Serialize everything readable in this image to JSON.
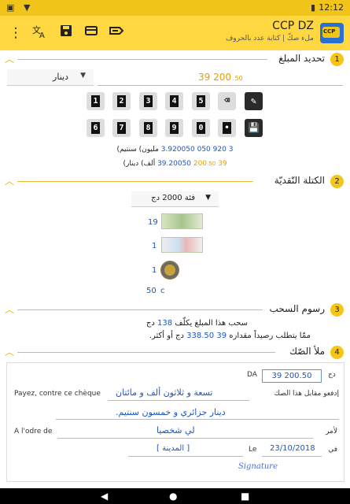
{
  "status_bar": {
    "time": "12:12",
    "icons": [
      "notification-icon",
      "wifi-icon",
      "battery-icon"
    ]
  },
  "app_bar": {
    "title": "CCP DZ",
    "subtitle": "ملء صكّ | كتابة عدد بالحروف",
    "logo_text": "CCP",
    "actions": [
      "menu-icon",
      "translate-icon",
      "save-icon",
      "card-icon",
      "cheque-icon"
    ]
  },
  "sections": {
    "amount": {
      "number": "1",
      "title": "تحديد المبلغ",
      "currency": "دينار",
      "amount_main": "39 200",
      "amount_cents": ".50",
      "keypad": [
        "1",
        "2",
        "3",
        "4",
        "5",
        "⌫",
        "✎",
        "6",
        "7",
        "8",
        "9",
        "0",
        "•",
        "💾"
      ],
      "words_centimes": {
        "figure_a": "3 920 050",
        "figure_b": "3.920050",
        "text": "مليون) سنتيم)"
      },
      "words_dinars": {
        "figure_a": "39 200",
        "figure_a_cents": ".50",
        "figure_b": "39.20050",
        "text": "ألف) دينار)"
      }
    },
    "cash": {
      "number": "2",
      "title": "الكتلة النّقديّة",
      "denomination": "فئة 2000 دج",
      "rows": [
        {
          "count": "19",
          "kind": "banknote-2000"
        },
        {
          "count": "1",
          "kind": "banknote-1000"
        },
        {
          "count": "1",
          "kind": "coin-200"
        },
        {
          "count": "50",
          "unit": "c"
        }
      ]
    },
    "fees": {
      "number": "3",
      "title": "رسوم السحب",
      "line1_prefix": "سحب هذا المبلغ يكلّف",
      "line1_value": "138",
      "line1_suffix": "دج",
      "line2_prefix": "ممّا يتطلب رصيداً مقداره",
      "line2_value": "39 338.50",
      "line2_suffix": "دج أو أكثر."
    },
    "cheque": {
      "number": "4",
      "title": "ملأ الصّك",
      "da_label": "DA",
      "dj_label": "دج",
      "amount_box": "39 200.50",
      "pay_label_fr": "Payez, contre ce chèque",
      "pay_label_ar": "إدفعو مقابل هذا الصك",
      "amount_words_1": "تسعة و ثلاثون ألف و مائتان",
      "amount_words_2": "دينار جزائري و خمسون سنتيم.",
      "order_label_fr": "A l'odre de",
      "order_label_ar": "لأمر",
      "payee": "لي شخصيا",
      "place": "[ المدينة ]",
      "le_label": "Le",
      "fi_label": "في",
      "date": "23/10/2018",
      "signature": "Signature"
    }
  },
  "nav_bar": {
    "buttons": [
      "back-icon",
      "home-icon",
      "recents-icon"
    ]
  },
  "colors": {
    "accent": "#ffd740",
    "gold_text": "#e6a000",
    "blue_text": "#1e56b8"
  }
}
